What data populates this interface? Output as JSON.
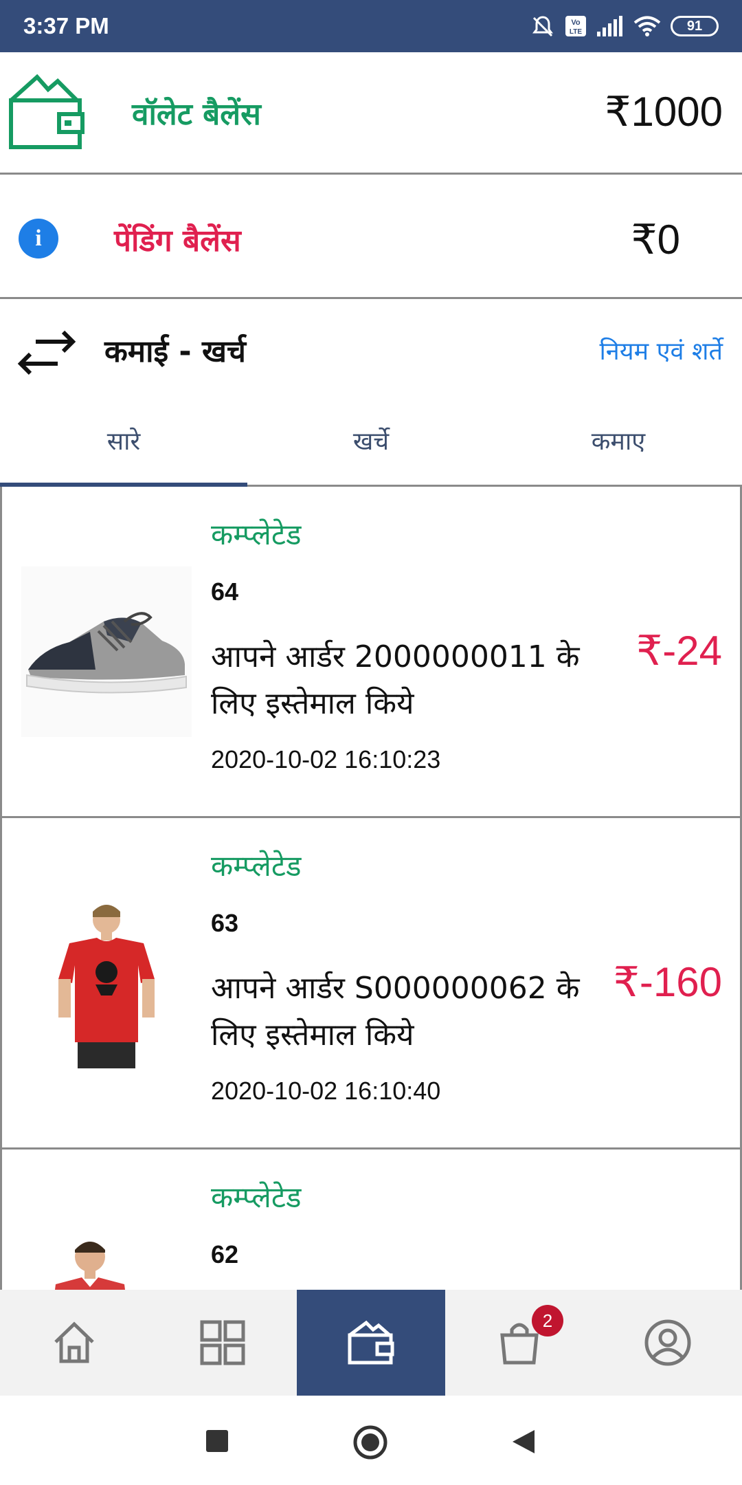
{
  "status_bar": {
    "time": "3:37 PM",
    "battery": "91",
    "icons": [
      "mute-icon",
      "volte-icon",
      "signal-icon",
      "wifi-icon",
      "battery-icon"
    ]
  },
  "wallet": {
    "label": "वॉलेट बैलेंस",
    "amount": "₹1000",
    "icon": "wallet-icon",
    "color": "#169b62"
  },
  "pending": {
    "label": "पेंडिंग बैलेंस",
    "amount": "₹0",
    "icon": "info-icon",
    "color": "#e0204f"
  },
  "earn_spend": {
    "title": "कमाई - खर्च",
    "terms_link": "नियम एवं शर्ते",
    "icon": "swap-arrows-icon"
  },
  "tabs": [
    {
      "label": "सारे",
      "active": true
    },
    {
      "label": "खर्चे",
      "active": false
    },
    {
      "label": "कमाए",
      "active": false
    }
  ],
  "transactions": [
    {
      "status": "कम्प्लेटेड",
      "id": "64",
      "description": "आपने आर्डर 2000000011 के लिए इस्तेमाल किये",
      "date": "2020-10-02 16:10:23",
      "amount": "₹-24",
      "image": "sneaker-image"
    },
    {
      "status": "कम्प्लेटेड",
      "id": "63",
      "description": "आपने आर्डर S000000062 के लिए इस्तेमाल किये",
      "date": "2020-10-02 16:10:40",
      "amount": "₹-160",
      "image": "red-tshirt-image"
    },
    {
      "status": "कम्प्लेटेड",
      "id": "62",
      "description": "",
      "date": "",
      "amount": "",
      "image": "red-polo-image"
    }
  ],
  "bottom_nav": {
    "items": [
      "home-icon",
      "categories-icon",
      "wallet-icon",
      "cart-icon",
      "profile-icon"
    ],
    "active_index": 2,
    "cart_badge": "2",
    "active_color": "#344c7a"
  },
  "system_nav": [
    "recents-button",
    "home-button",
    "back-button"
  ]
}
